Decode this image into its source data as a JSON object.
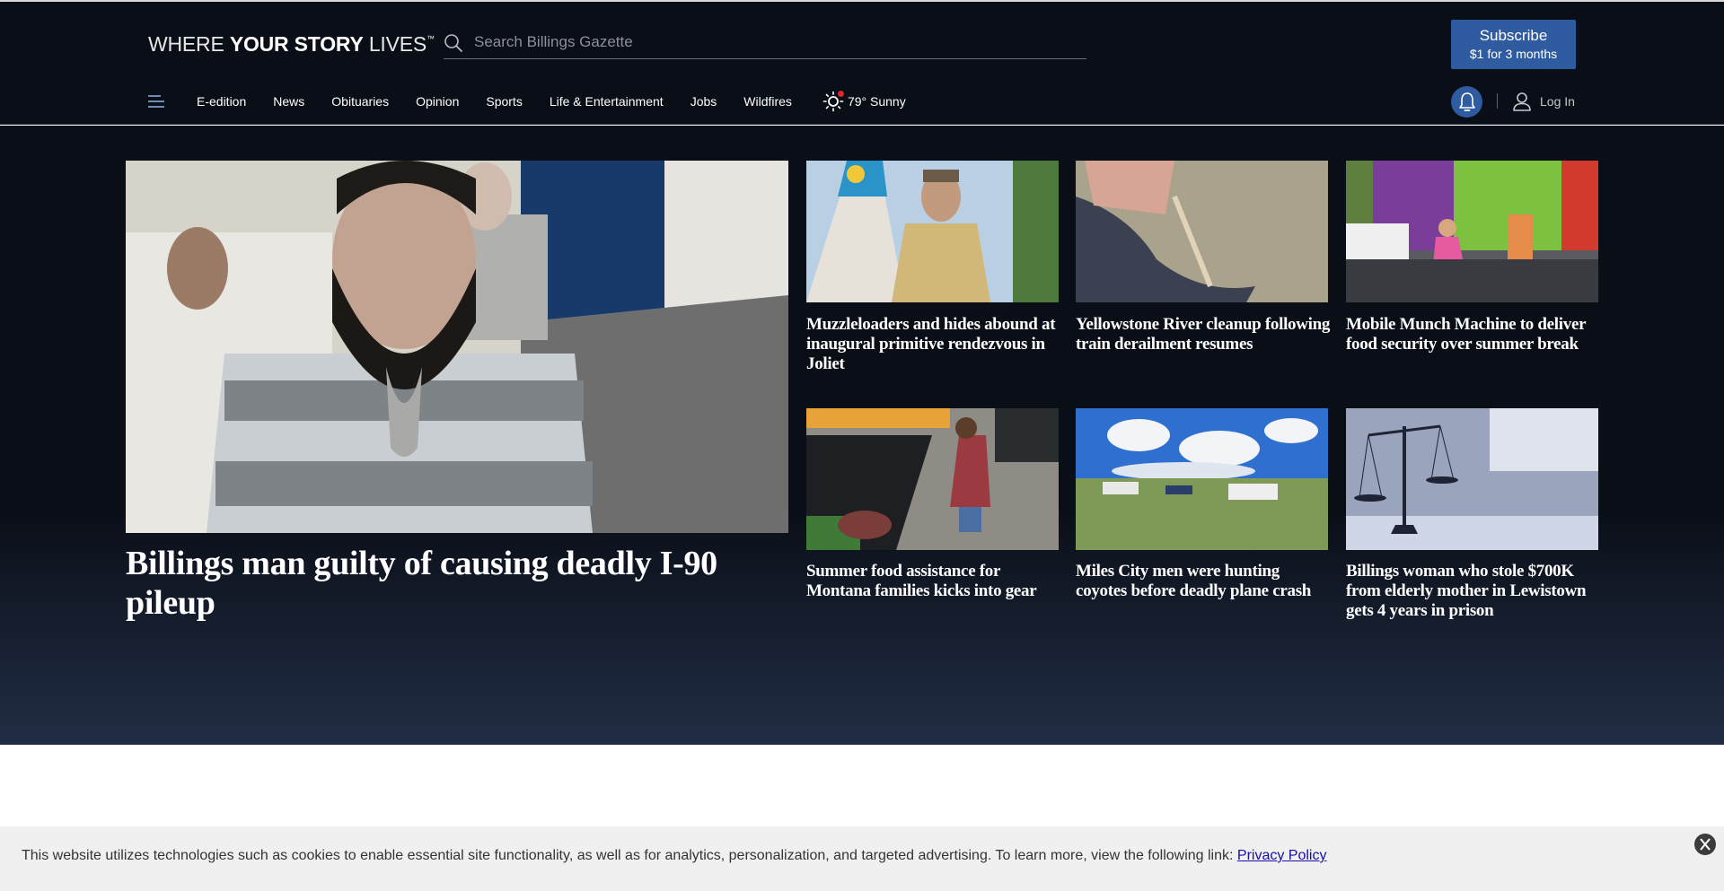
{
  "header": {
    "tagline": {
      "part1": "WHERE ",
      "part2": "YOUR STORY",
      "part3": " LIVES",
      "tm": "™"
    },
    "search": {
      "placeholder": "Search Billings Gazette",
      "value": ""
    },
    "subscribe": {
      "label": "Subscribe",
      "offer": "$1 for 3 months"
    },
    "login_label": "Log In",
    "accent_color": "#2f5ba0"
  },
  "nav": {
    "items": [
      {
        "label": "E-edition"
      },
      {
        "label": "News"
      },
      {
        "label": "Obituaries"
      },
      {
        "label": "Opinion"
      },
      {
        "label": "Sports"
      },
      {
        "label": "Life & Entertainment"
      },
      {
        "label": "Jobs"
      },
      {
        "label": "Wildfires"
      }
    ],
    "weather": {
      "text": "79° Sunny",
      "icon": "sun-icon"
    }
  },
  "lead_story": {
    "title": "Billings man guilty of causing deadly I-90 pileup",
    "image": "courtroom-defendants-photo"
  },
  "stories": [
    {
      "title": "Muzzleloaders and hides abound at inaugural primitive rendezvous in Joliet",
      "image": "tipi-rendezvous-photo"
    },
    {
      "title": "Yellowstone River cleanup following train derailment resumes",
      "image": "oil-residue-rock-photo"
    },
    {
      "title": "Mobile Munch Machine to deliver food security over summer break",
      "image": "food-truck-kids-photo"
    },
    {
      "title": "Summer food assistance for Montana families kicks into gear",
      "image": "grocery-produce-photo"
    },
    {
      "title": "Miles City men were hunting coyotes before deadly plane crash",
      "image": "prairie-trucks-photo"
    },
    {
      "title": "Billings woman who stole $700K from elderly mother in Lewistown gets 4 years in prison",
      "image": "scales-of-justice-photo"
    }
  ],
  "cookie_banner": {
    "text": "This website utilizes technologies such as cookies to enable essential site functionality, as well as for analytics, personalization, and targeted advertising. To learn more, view the following link: ",
    "link_label": "Privacy Policy"
  }
}
